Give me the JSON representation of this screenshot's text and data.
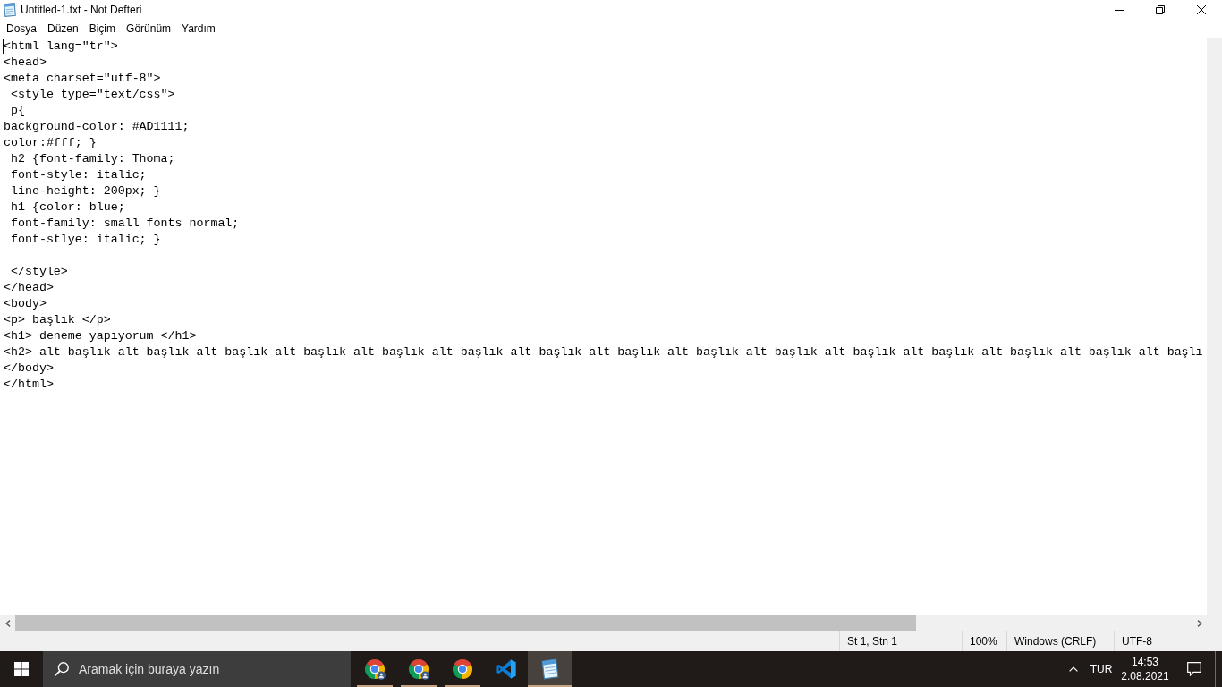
{
  "window": {
    "title": "Untitled-1.txt - Not Defteri"
  },
  "menu": [
    "Dosya",
    "Düzen",
    "Biçim",
    "Görünüm",
    "Yardım"
  ],
  "editor": {
    "text": "<html lang=\"tr\">\n<head>\n<meta charset=\"utf-8\">\n <style type=\"text/css\">\n p{\nbackground-color: #AD1111;\ncolor:#fff; }\n h2 {font-family: Thoma;\n font-style: italic;\n line-height: 200px; }\n h1 {color: blue;\n font-family: small fonts normal;\n font-stlye: italic; }\n\n </style>\n</head>\n<body>\n<p> başlık </p>\n<h1> deneme yapıyorum </h1>\n<h2> alt başlık alt başlık alt başlık alt başlık alt başlık alt başlık alt başlık alt başlık alt başlık alt başlık alt başlık alt başlık alt başlık alt başlık alt başlı\n</body>\n</html>"
  },
  "status_bar": {
    "position": "St 1, Stn 1",
    "zoom": "100%",
    "line_endings": "Windows (CRLF)",
    "encoding": "UTF-8"
  },
  "taskbar": {
    "search": {
      "placeholder": "Aramak için buraya yazın"
    },
    "apps": [
      {
        "kind": "browser_badge",
        "running": true,
        "selected": false
      },
      {
        "kind": "browser_badge",
        "running": true,
        "selected": false
      },
      {
        "kind": "browser",
        "running": true,
        "selected": false
      },
      {
        "kind": "code_editor",
        "running": false,
        "selected": false
      },
      {
        "kind": "notepad",
        "running": true,
        "selected": true
      }
    ],
    "tray": {
      "language": "TUR",
      "time": "14:53",
      "date": "2.08.2021"
    }
  }
}
